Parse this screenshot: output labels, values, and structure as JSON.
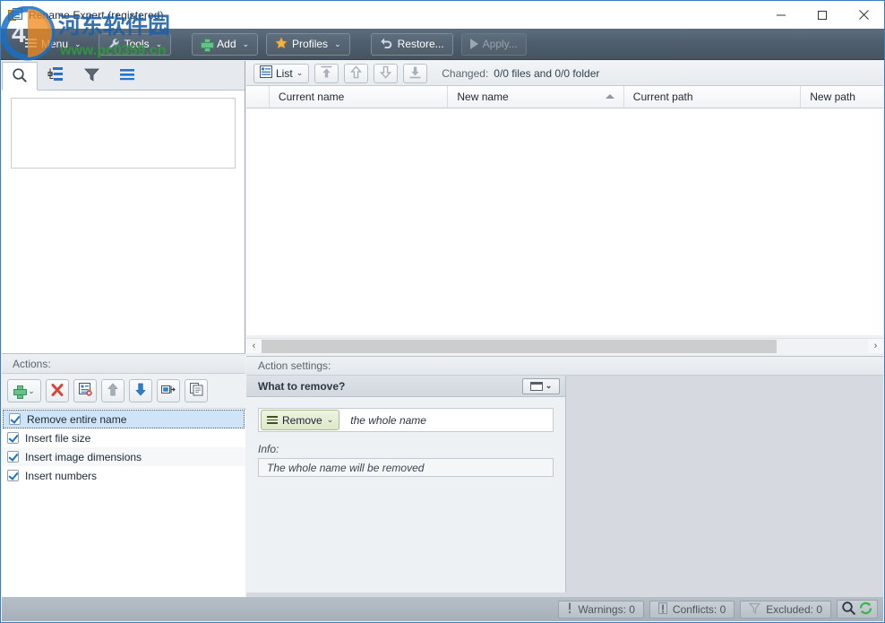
{
  "window": {
    "title": "Rename Expert (registered)",
    "app_icon": "app-window-icon",
    "minimize_label": "—",
    "maximize_label": "□",
    "close_label": "✕"
  },
  "watermark": {
    "text_cn": "河东软件园",
    "text_url": "www.pc0359.cn",
    "color_cn": "#1b5fa8",
    "color_url": "#2e9b3c",
    "logo_orange": "#f08a1e",
    "logo_blue": "#1b6fc4"
  },
  "toolbar": {
    "buttons": [
      {
        "label": "Menu",
        "icon": "menu-icon",
        "caret": "⌄",
        "enabled": true
      },
      {
        "label": "Tools",
        "icon": "wrench-icon",
        "caret": "⌄",
        "enabled": true
      },
      {
        "label": "Add",
        "icon": "plus-icon",
        "caret": "⌄",
        "enabled": true
      },
      {
        "label": "Profiles",
        "icon": "star-icon",
        "caret": "⌄",
        "enabled": true
      },
      {
        "label": "Restore...",
        "icon": "undo-icon",
        "caret": "",
        "enabled": true
      },
      {
        "label": "Apply...",
        "icon": "play-icon",
        "caret": "",
        "enabled": false
      }
    ]
  },
  "left_pane": {
    "tabs": [
      {
        "name": "search-tab",
        "icon": "search-icon",
        "active": true
      },
      {
        "name": "tree-tab",
        "icon": "tree-icon",
        "active": false
      },
      {
        "name": "filter-tab",
        "icon": "filter-icon",
        "active": false
      },
      {
        "name": "list-tab",
        "icon": "list-lines-icon",
        "active": false
      }
    ]
  },
  "actions": {
    "header": "Actions:",
    "toolbar": [
      {
        "name": "add-action-button",
        "icon": "plus-icon",
        "caret": "⌄"
      },
      {
        "name": "delete-action-button",
        "icon": "red-x-icon",
        "caret": ""
      },
      {
        "name": "clear-actions-button",
        "icon": "list-delete-icon",
        "caret": ""
      },
      {
        "name": "move-up-button",
        "icon": "arrow-up-icon",
        "caret": ""
      },
      {
        "name": "move-down-button",
        "icon": "arrow-down-icon",
        "caret": ""
      },
      {
        "name": "rename-action-button",
        "icon": "rename-icon",
        "caret": ""
      },
      {
        "name": "copy-action-button",
        "icon": "copy-icon",
        "caret": ""
      }
    ],
    "items": [
      {
        "label": "Remove entire name",
        "checked": true,
        "selected": true
      },
      {
        "label": "Insert file size",
        "checked": true,
        "selected": false
      },
      {
        "label": "Insert image dimensions",
        "checked": true,
        "selected": false
      },
      {
        "label": "Insert numbers",
        "checked": true,
        "selected": false
      }
    ]
  },
  "list_pane": {
    "view_button": {
      "label": "List",
      "icon": "list-view-icon",
      "caret": "⌄"
    },
    "nav_buttons": [
      {
        "name": "move-top-button",
        "icon": "arrow-top-icon"
      },
      {
        "name": "move-up-button",
        "icon": "arrow-up-icon"
      },
      {
        "name": "move-down-button",
        "icon": "arrow-down-icon"
      },
      {
        "name": "move-bottom-button",
        "icon": "arrow-bottom-icon"
      }
    ],
    "changed_label": "Changed:",
    "changed_value": "0/0 files and 0/0 folder",
    "columns": [
      {
        "label": "Current name",
        "sorted": false
      },
      {
        "label": "New name",
        "sorted": true
      },
      {
        "label": "Current path",
        "sorted": false
      },
      {
        "label": "New path",
        "sorted": false
      }
    ],
    "rows": []
  },
  "settings": {
    "header": "Action settings:",
    "panel_title": "What to remove?",
    "panel_window_button": {
      "name": "panel-view-button",
      "caret": "⌄"
    },
    "remove_combo": {
      "label": "Remove",
      "caret": "⌄",
      "icon": "hamburger-icon"
    },
    "remove_target": "the whole name",
    "info_label": "Info:",
    "info_text": "The whole name will be removed"
  },
  "statusbar": {
    "items": [
      {
        "label": "Warnings: 0",
        "icon": "warning-icon"
      },
      {
        "label": "Conflicts: 0",
        "icon": "conflict-icon"
      },
      {
        "label": "Excluded: 0",
        "icon": "filter-icon"
      }
    ],
    "icon_buttons": [
      {
        "name": "search-button",
        "icon": "search-icon"
      },
      {
        "name": "refresh-button",
        "icon": "refresh-icon"
      }
    ]
  },
  "colors": {
    "toolbar_bg": "#4d5d6d",
    "accent_blue": "#1b6fc4",
    "selection": "#cfe4f7",
    "green": "#67c28a",
    "orange": "#f0b24a",
    "red": "#d9453a"
  }
}
